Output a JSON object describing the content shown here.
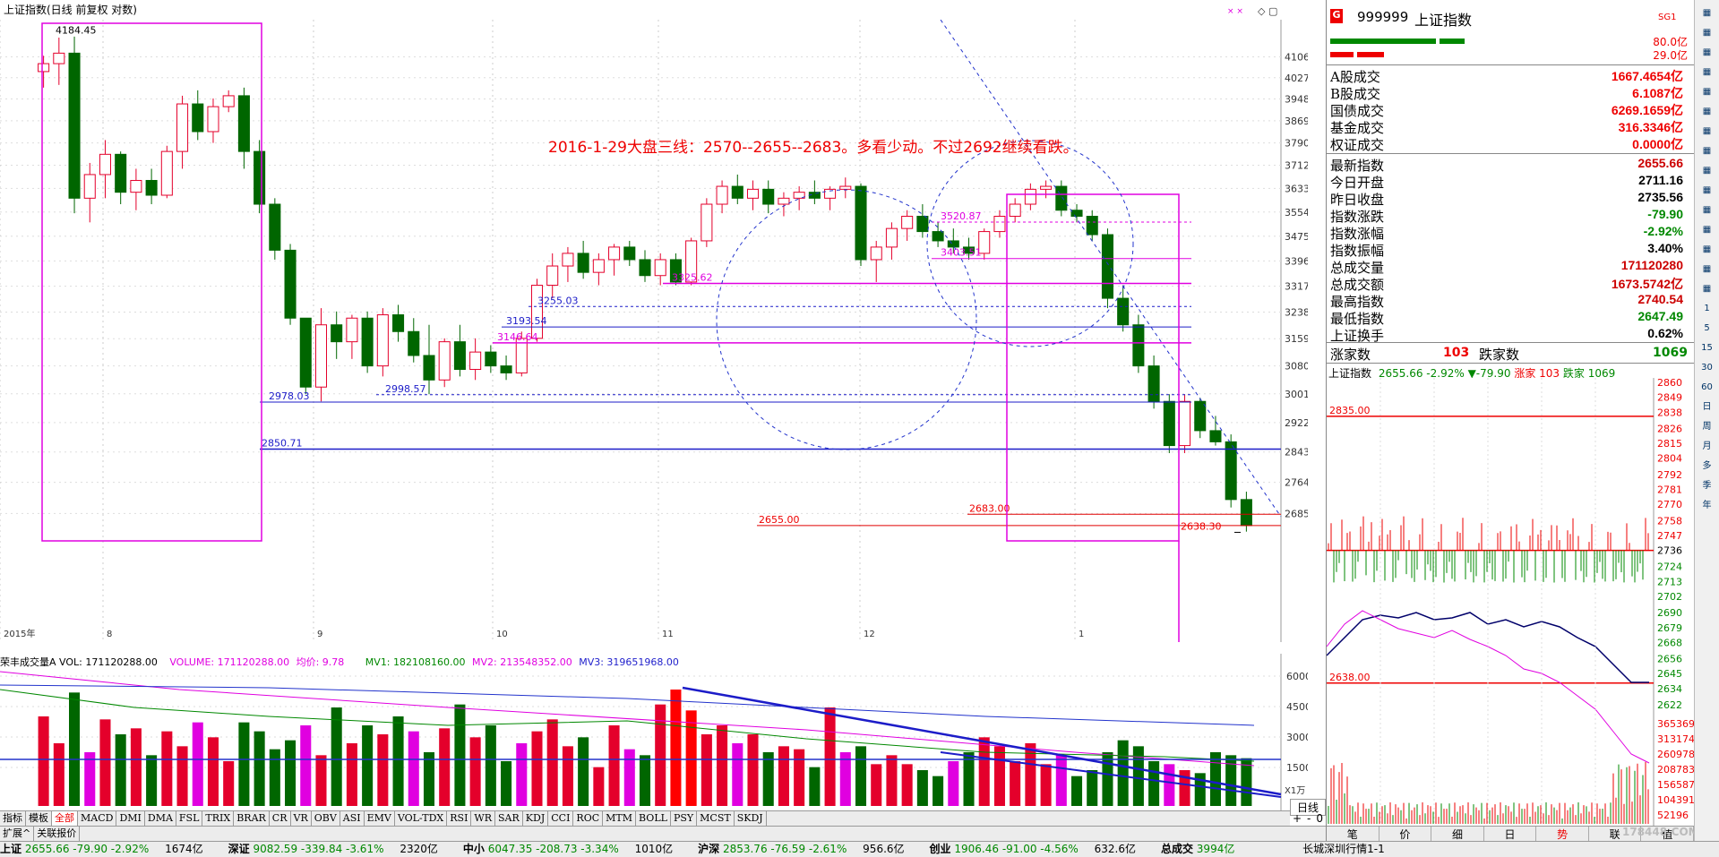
{
  "header": {
    "title": "上证指数(日线 前复权 对数)"
  },
  "chart_data": [
    {
      "type": "candlestick",
      "title": "上证指数(日线 前复权 对数)",
      "annotation": "2016-1-29大盘三线：2570--2655--2683。多看少动。不过2692继续看跌。",
      "ylim": [
        2600,
        4180
      ],
      "y_ticks": [
        4106,
        4027,
        3948,
        3869,
        3790,
        3712,
        3633,
        3554,
        3475,
        3396,
        3317,
        3238,
        3159,
        3080,
        3001,
        2922,
        2843,
        2764,
        2685
      ],
      "x_labels": [
        "2015年",
        "8",
        "9",
        "10",
        "11",
        "12",
        "1"
      ],
      "levels": [
        {
          "label": "4184.45",
          "value": 4184.45
        },
        {
          "label": "3520.87",
          "value": 3520.87
        },
        {
          "label": "3403.51",
          "value": 3403.51
        },
        {
          "label": "3325.62",
          "value": 3325.62
        },
        {
          "label": "3255.03",
          "value": 3255.03
        },
        {
          "label": "3193.54",
          "value": 3193.54
        },
        {
          "label": "3146.64",
          "value": 3146.64
        },
        {
          "label": "2998.57",
          "value": 2998.57
        },
        {
          "label": "2978.03",
          "value": 2978.03
        },
        {
          "label": "2850.71",
          "value": 2850.71
        },
        {
          "label": "2683.00",
          "value": 2683.0
        },
        {
          "label": "2655.00",
          "value": 2655.0
        },
        {
          "label": "2638.30",
          "value": 2638.3
        }
      ],
      "candles": [
        [
          4050,
          4110,
          3990,
          4080
        ],
        [
          4080,
          4180,
          4000,
          4120
        ],
        [
          4120,
          4184,
          3550,
          3600
        ],
        [
          3600,
          3720,
          3520,
          3680
        ],
        [
          3680,
          3800,
          3600,
          3750
        ],
        [
          3750,
          3760,
          3580,
          3620
        ],
        [
          3620,
          3700,
          3560,
          3660
        ],
        [
          3660,
          3700,
          3580,
          3610
        ],
        [
          3610,
          3780,
          3600,
          3760
        ],
        [
          3760,
          3960,
          3700,
          3930
        ],
        [
          3930,
          3980,
          3800,
          3830
        ],
        [
          3830,
          3950,
          3790,
          3920
        ],
        [
          3920,
          3980,
          3900,
          3960
        ],
        [
          3960,
          3990,
          3700,
          3760
        ],
        [
          3760,
          3800,
          3550,
          3580
        ],
        [
          3580,
          3600,
          3400,
          3430
        ],
        [
          3430,
          3450,
          3200,
          3220
        ],
        [
          3220,
          3120,
          3000,
          3020
        ],
        [
          3020,
          3250,
          2980,
          3200
        ],
        [
          3200,
          3240,
          3100,
          3150
        ],
        [
          3150,
          3230,
          3100,
          3220
        ],
        [
          3220,
          3240,
          3060,
          3080
        ],
        [
          3080,
          3250,
          3050,
          3230
        ],
        [
          3230,
          3260,
          3150,
          3180
        ],
        [
          3180,
          3220,
          3090,
          3110
        ],
        [
          3110,
          3200,
          3000,
          3040
        ],
        [
          3040,
          3160,
          3020,
          3150
        ],
        [
          3150,
          3200,
          3050,
          3070
        ],
        [
          3070,
          3160,
          3040,
          3120
        ],
        [
          3120,
          3140,
          3060,
          3080
        ],
        [
          3080,
          3110,
          3040,
          3060
        ],
        [
          3060,
          3180,
          3050,
          3160
        ],
        [
          3160,
          3340,
          3150,
          3320
        ],
        [
          3320,
          3420,
          3280,
          3380
        ],
        [
          3380,
          3440,
          3330,
          3420
        ],
        [
          3420,
          3460,
          3340,
          3360
        ],
        [
          3360,
          3420,
          3320,
          3400
        ],
        [
          3400,
          3450,
          3350,
          3440
        ],
        [
          3440,
          3460,
          3380,
          3400
        ],
        [
          3400,
          3430,
          3330,
          3350
        ],
        [
          3350,
          3420,
          3320,
          3400
        ],
        [
          3400,
          3420,
          3320,
          3330
        ],
        [
          3330,
          3470,
          3320,
          3460
        ],
        [
          3460,
          3600,
          3440,
          3580
        ],
        [
          3580,
          3660,
          3550,
          3640
        ],
        [
          3640,
          3680,
          3580,
          3600
        ],
        [
          3600,
          3660,
          3560,
          3630
        ],
        [
          3630,
          3660,
          3550,
          3580
        ],
        [
          3580,
          3620,
          3540,
          3600
        ],
        [
          3600,
          3640,
          3560,
          3620
        ],
        [
          3620,
          3660,
          3580,
          3600
        ],
        [
          3600,
          3640,
          3560,
          3630
        ],
        [
          3630,
          3670,
          3600,
          3640
        ],
        [
          3640,
          3650,
          3380,
          3400
        ],
        [
          3400,
          3460,
          3330,
          3440
        ],
        [
          3440,
          3520,
          3400,
          3500
        ],
        [
          3500,
          3560,
          3460,
          3540
        ],
        [
          3540,
          3580,
          3470,
          3490
        ],
        [
          3490,
          3520,
          3440,
          3460
        ],
        [
          3460,
          3500,
          3420,
          3440
        ],
        [
          3440,
          3470,
          3400,
          3420
        ],
        [
          3420,
          3500,
          3400,
          3490
        ],
        [
          3490,
          3560,
          3470,
          3540
        ],
        [
          3540,
          3600,
          3520,
          3580
        ],
        [
          3580,
          3650,
          3560,
          3630
        ],
        [
          3630,
          3660,
          3600,
          3640
        ],
        [
          3640,
          3660,
          3540,
          3560
        ],
        [
          3560,
          3580,
          3520,
          3540
        ],
        [
          3540,
          3560,
          3460,
          3480
        ],
        [
          3480,
          3500,
          3250,
          3280
        ],
        [
          3280,
          3320,
          3180,
          3200
        ],
        [
          3200,
          3230,
          3060,
          3080
        ],
        [
          3080,
          3110,
          2960,
          2980
        ],
        [
          2980,
          3000,
          2840,
          2860
        ],
        [
          2860,
          3000,
          2840,
          2980
        ],
        [
          2980,
          2990,
          2880,
          2900
        ],
        [
          2900,
          2940,
          2860,
          2870
        ],
        [
          2870,
          2890,
          2700,
          2720
        ],
        [
          2720,
          2740,
          2640,
          2655
        ]
      ]
    },
    {
      "type": "bar",
      "title": "荣丰成交量A",
      "series": [
        {
          "name": "VOL",
          "values": [
            300,
            210,
            380,
            180,
            290,
            240,
            260,
            170,
            250,
            200,
            280,
            230,
            150,
            280,
            250,
            190,
            220,
            270,
            170,
            330,
            210,
            270,
            240,
            300,
            250,
            180,
            260,
            340,
            230,
            270,
            150,
            210,
            250,
            290,
            200,
            230,
            130,
            270,
            190,
            170,
            340,
            390,
            320,
            240,
            270,
            210,
            240,
            180,
            200,
            190,
            130,
            330,
            180,
            200,
            140,
            170,
            140,
            120,
            100,
            150,
            180,
            230,
            200,
            150,
            210,
            140,
            170,
            100,
            120,
            180,
            220,
            200,
            150,
            140,
            120,
            110,
            180,
            170,
            160
          ]
        },
        {
          "name": "MV1",
          "values": [
            182108160
          ]
        },
        {
          "name": "MV2",
          "values": [
            213548352
          ]
        },
        {
          "name": "MV3",
          "values": [
            319651968
          ]
        }
      ]
    },
    {
      "type": "line",
      "title": "上证指数 分时",
      "ylim": [
        2622,
        2860
      ],
      "y_ticks": [
        2860,
        2849,
        2838,
        2826,
        2815,
        2804,
        2792,
        2781,
        2770,
        2758,
        2747,
        2736,
        2724,
        2713,
        2702,
        2690,
        2679,
        2668,
        2656,
        2645,
        2634,
        2622
      ],
      "levels": [
        {
          "label": "2835.00",
          "value": 2835
        },
        {
          "label": "2638.00",
          "value": 2638
        }
      ],
      "vol_ticks": [
        365369,
        313174,
        260978,
        208783,
        156587,
        104391,
        52196
      ],
      "x_labels": [
        "笔",
        "价",
        "细",
        "日",
        "势",
        "联",
        "值"
      ]
    }
  ],
  "main": {
    "price_labels": [
      "4184.45",
      "3520.87",
      "3403.51",
      "3325.62",
      "3255.03",
      "3193.54",
      "3146.64",
      "2998.57",
      "2978.03",
      "2850.71",
      "2683.00",
      "2655.00",
      "2638.30"
    ],
    "annotation": "2016-1-29大盘三线：2570--2655--2683。多看少动。不过2692继续看跌。",
    "x_labels": [
      "2015年",
      "8",
      "9",
      "10",
      "11",
      "12",
      "1"
    ],
    "y_ticks": [
      "4106",
      "4027",
      "3948",
      "3869",
      "3790",
      "3712",
      "3633",
      "3554",
      "3475",
      "3396",
      "3317",
      "3238",
      "3159",
      "3080",
      "3001",
      "2922",
      "2843",
      "2764",
      "2685"
    ]
  },
  "volume": {
    "title": "荣丰成交量A",
    "vol_label": "VOL: 171120288.00",
    "volume_label": "VOLUME: 171120288.00",
    "avg_label": "均价: 9.78",
    "mv1": "MV1: 182108160.00",
    "mv2": "MV2: 213548352.00",
    "mv3": "MV3: 319651968.00",
    "y_ticks": [
      "60000",
      "45000",
      "30000",
      "15000"
    ],
    "unit": "X1万"
  },
  "ind_tabs": [
    "指标",
    "模板",
    "全部",
    "MACD",
    "DMI",
    "DMA",
    "FSL",
    "TRIX",
    "BRAR",
    "CR",
    "VR",
    "OBV",
    "ASI",
    "EMV",
    "VOL-TDX",
    "RSI",
    "WR",
    "SAR",
    "KDJ",
    "CCI",
    "ROC",
    "MTM",
    "BOLL",
    "PSY",
    "MCST",
    "SKDJ"
  ],
  "sub_tabs": [
    "扩展^",
    "关联报价"
  ],
  "period": {
    "label": "日线",
    "plus": "+",
    "minus": "-",
    "zero": "0"
  },
  "status": [
    {
      "name": "上证",
      "val": "2655.66",
      "chg": "-79.90",
      "pct": "-2.92%",
      "amt": "1674亿"
    },
    {
      "name": "深证",
      "val": "9082.59",
      "chg": "-339.84",
      "pct": "-3.61%",
      "amt": "2320亿"
    },
    {
      "name": "中小",
      "val": "6047.35",
      "chg": "-208.73",
      "pct": "-3.34%",
      "amt": "1010亿"
    },
    {
      "name": "沪深",
      "val": "2853.76",
      "chg": "-76.59",
      "pct": "-2.61%",
      "amt": "956.6亿"
    },
    {
      "name": "创业",
      "val": "1906.46",
      "chg": "-91.00",
      "pct": "-4.56%",
      "amt": "632.6亿"
    },
    {
      "name": "总成交",
      "val": "3994亿",
      "chg": "",
      "pct": "",
      "amt": ""
    }
  ],
  "status_right": "长城深圳行情1-1",
  "right": {
    "code": "999999",
    "name": "上证指数",
    "tag": "SG1",
    "g": "G",
    "bars": [
      "80.0亿",
      "29.0亿"
    ],
    "stats1": [
      [
        "A股成交",
        "1667.4654亿"
      ],
      [
        "B股成交",
        "6.1087亿"
      ],
      [
        "国债成交",
        "6269.1659亿"
      ],
      [
        "基金成交",
        "316.3346亿"
      ],
      [
        "权证成交",
        "0.0000亿"
      ]
    ],
    "stats2": [
      [
        "最新指数",
        "2655.66",
        "#c00"
      ],
      [
        "今日开盘",
        "2711.16",
        "#000"
      ],
      [
        "昨日收盘",
        "2735.56",
        "#000"
      ],
      [
        "指数涨跌",
        "-79.90",
        "#080"
      ],
      [
        "指数涨幅",
        "-2.92%",
        "#080"
      ],
      [
        "指数振幅",
        "3.40%",
        "#000"
      ],
      [
        "总成交量",
        "171120280",
        "#c00"
      ],
      [
        "总成交额",
        "1673.5742亿",
        "#c00"
      ],
      [
        "最高指数",
        "2740.54",
        "#c00"
      ],
      [
        "最低指数",
        "2647.49",
        "#080"
      ],
      [
        "上证换手",
        "0.62%",
        "#000"
      ]
    ],
    "up_label": "涨家数",
    "up": "103",
    "down_label": "跌家数",
    "down": "1069",
    "mini_title": "上证指数",
    "mini_val": "2655.66",
    "mini_pct": "-2.92%",
    "mini_chg": "▼-79.90",
    "mini_up": "涨家 103",
    "mini_down": "跌家 1069",
    "mini_levels": [
      "2835.00",
      "2638.00"
    ],
    "mini_ticks": [
      "2860",
      "2849",
      "2838",
      "2826",
      "2815",
      "2804",
      "2792",
      "2781",
      "2770",
      "2758",
      "2747",
      "2736",
      "2724",
      "2713",
      "2702",
      "2690",
      "2679",
      "2668",
      "2656",
      "2645",
      "2634",
      "2622"
    ],
    "mini_vol_ticks": [
      "365369",
      "313174",
      "260978",
      "208783",
      "156587",
      "104391",
      "52196"
    ],
    "bottom_tabs": [
      "笔",
      "价",
      "细",
      "日",
      "势",
      "联",
      "值"
    ],
    "watermark": "178448.COM"
  },
  "toolbar_icons": [
    "chart-icon",
    "up-icon",
    "down-icon",
    "grid-icon",
    "list-icon",
    "table-icon",
    "zoom-icon",
    "bars-icon",
    "fx-icon",
    "circle-icon",
    "rsi-icon",
    "move-icon",
    "pen-icon",
    "fs-icon",
    "refresh-icon",
    "1",
    "5",
    "15",
    "30",
    "60",
    "日",
    "周",
    "月",
    "多",
    "季",
    "年"
  ],
  "colors": {
    "up": "#e4002b",
    "down": "#006600",
    "magenta": "#e000e0",
    "blue": "#1c1cc8",
    "red": "#e00000"
  }
}
